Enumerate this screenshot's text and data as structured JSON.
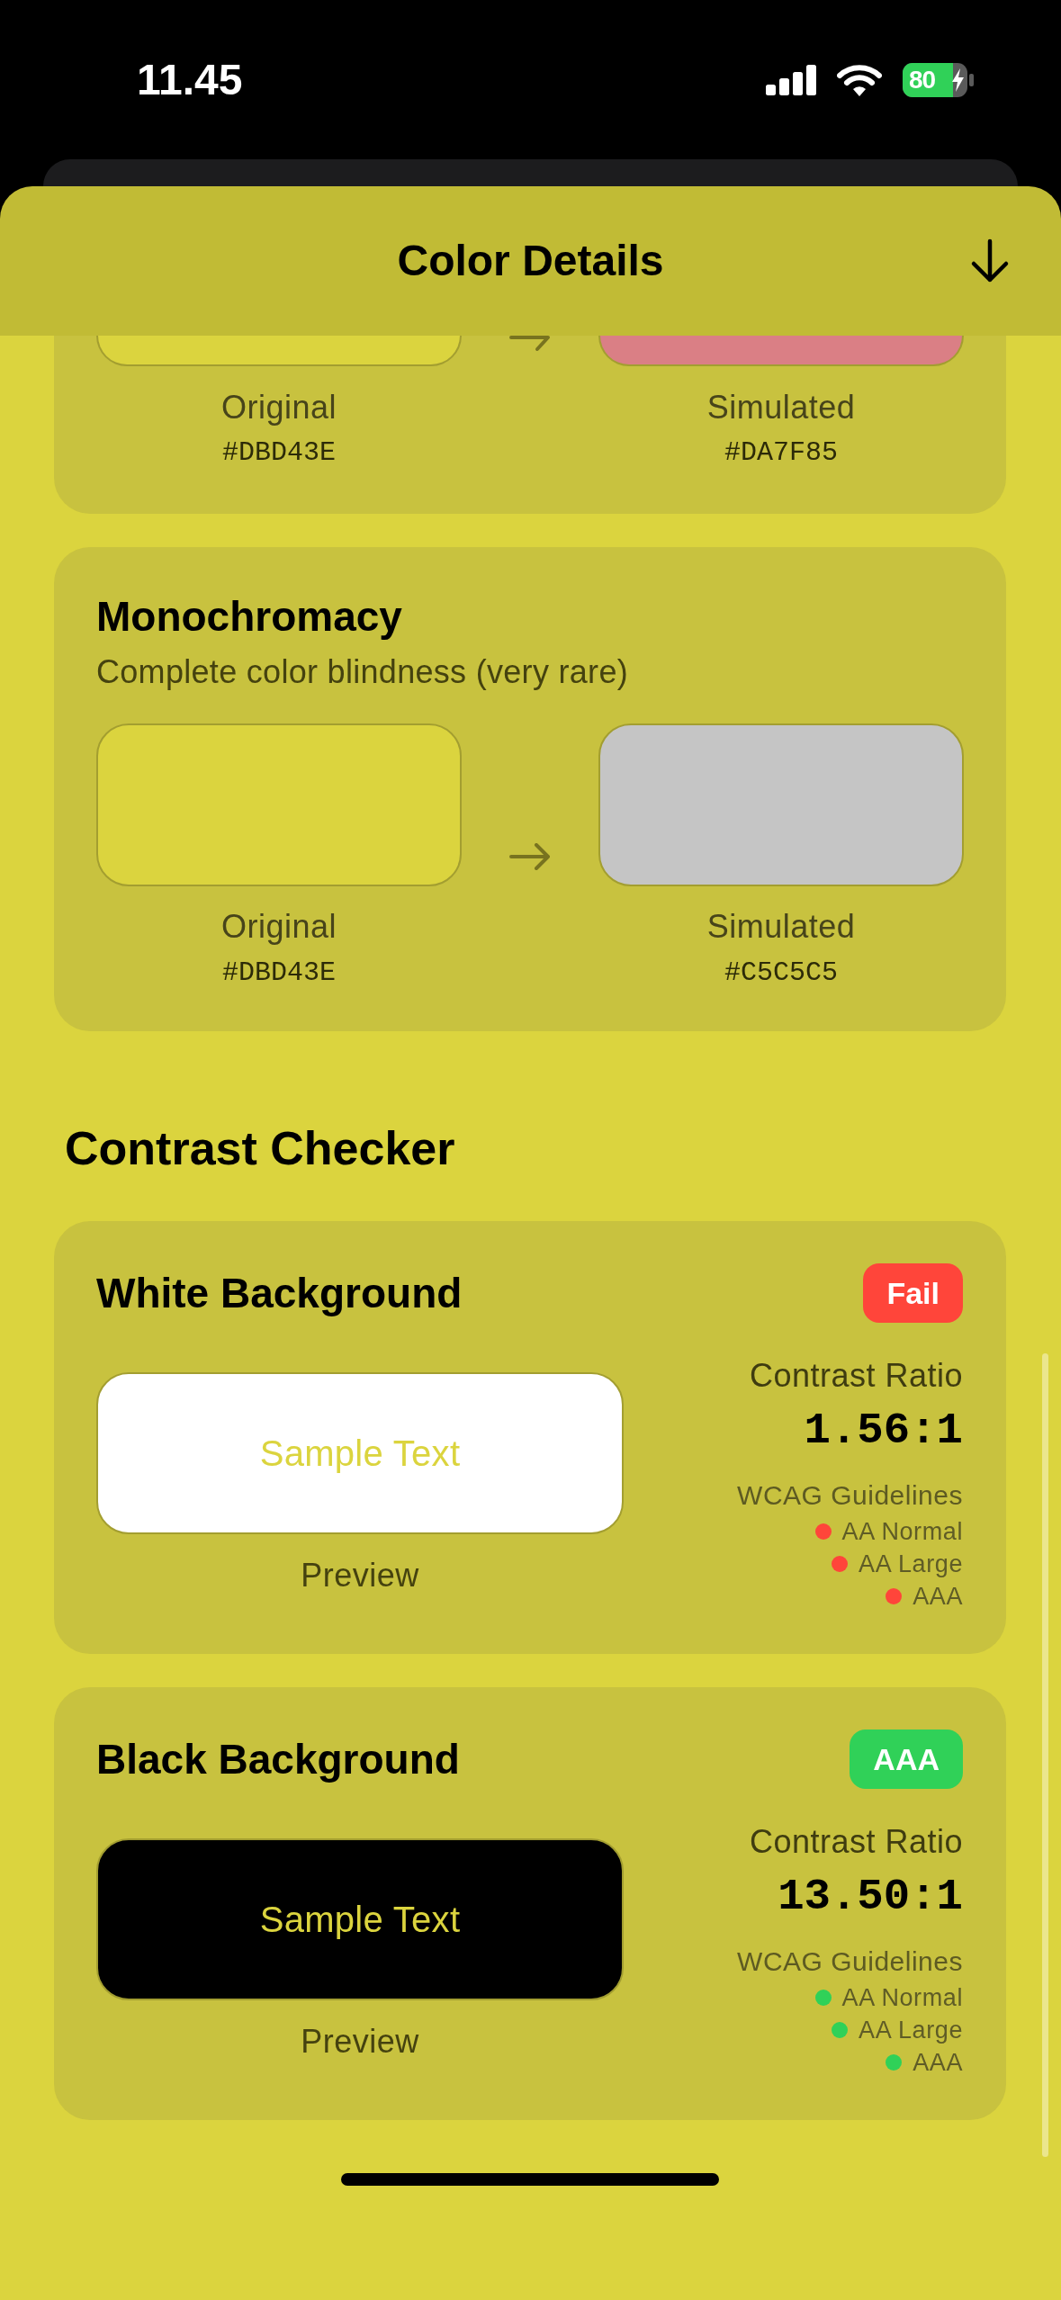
{
  "status_bar": {
    "time": "11.45",
    "battery": "80"
  },
  "sheet": {
    "title": "Color Details"
  },
  "simulations": [
    {
      "swatches": [
        {
          "label": "Original",
          "hex": "#DBD43E",
          "color": "#dbd43e"
        },
        {
          "label": "Simulated",
          "hex": "#DA7F85",
          "color": "#da7f85"
        }
      ]
    },
    {
      "title": "Monochromacy",
      "description": "Complete color blindness (very rare)",
      "swatches": [
        {
          "label": "Original",
          "hex": "#DBD43E",
          "color": "#dbd43e"
        },
        {
          "label": "Simulated",
          "hex": "#C5C5C5",
          "color": "#c5c5c5"
        }
      ]
    }
  ],
  "contrast_checker": {
    "title": "Contrast Checker",
    "cards": [
      {
        "title": "White Background",
        "badge": {
          "text": "Fail",
          "passed": false
        },
        "preview": {
          "text": "Sample Text",
          "color": "#ffffff",
          "label": "Preview"
        },
        "ratio_label": "Contrast Ratio",
        "ratio": "1.56:1",
        "guidelines_title": "WCAG Guidelines",
        "guidelines": [
          {
            "label": "AA Normal",
            "passed": false
          },
          {
            "label": "AA Large",
            "passed": false
          },
          {
            "label": "AAA",
            "passed": false
          }
        ]
      },
      {
        "title": "Black Background",
        "badge": {
          "text": "AAA",
          "passed": true
        },
        "preview": {
          "text": "Sample Text",
          "color": "#000000",
          "label": "Preview"
        },
        "ratio_label": "Contrast Ratio",
        "ratio": "13.50:1",
        "guidelines_title": "WCAG Guidelines",
        "guidelines": [
          {
            "label": "AA Normal",
            "passed": true
          },
          {
            "label": "AA Large",
            "passed": true
          },
          {
            "label": "AAA",
            "passed": true
          }
        ]
      }
    ]
  }
}
